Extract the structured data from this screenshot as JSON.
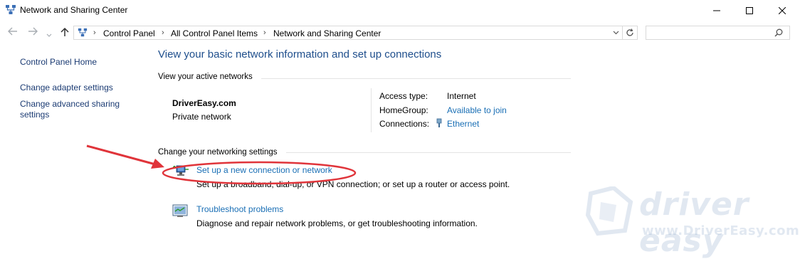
{
  "window": {
    "title": "Network and Sharing Center",
    "icon": "network-sharing-icon",
    "controls": [
      "minimize-icon",
      "maximize-icon",
      "close-icon"
    ]
  },
  "addressbar": {
    "breadcrumbs": [
      "Control Panel",
      "All Control Panel Items",
      "Network and Sharing Center"
    ],
    "search_placeholder": ""
  },
  "sidebar": {
    "items": [
      {
        "label": "Control Panel Home"
      },
      {
        "label": "Change adapter settings"
      },
      {
        "label": "Change advanced sharing settings",
        "line1": "Change advanced sharing",
        "line2": "settings"
      }
    ]
  },
  "main": {
    "heading": "View your basic network information and set up connections",
    "active_networks_label": "View your active networks",
    "network": {
      "name": "DriverEasy.com",
      "type": "Private network",
      "access_type_label": "Access type:",
      "access_type_value": "Internet",
      "homegroup_label": "HomeGroup:",
      "homegroup_value": "Available to join",
      "connections_label": "Connections:",
      "connections_value": "Ethernet"
    },
    "change_settings_label": "Change your networking settings",
    "tasks": [
      {
        "title": "Set up a new connection or network",
        "description": "Set up a broadband, dial-up, or VPN connection; or set up a router or access point.",
        "icon": "new-connection-icon"
      },
      {
        "title": "Troubleshoot problems",
        "description": "Diagnose and repair network problems, or get troubleshooting information.",
        "icon": "troubleshoot-icon"
      }
    ]
  },
  "watermark": {
    "brand": "driver easy",
    "url": "www.DriverEasy.com"
  },
  "colors": {
    "link": "#1a6fb5",
    "heading": "#1e4e8c",
    "annotation_red": "#e0343a"
  }
}
